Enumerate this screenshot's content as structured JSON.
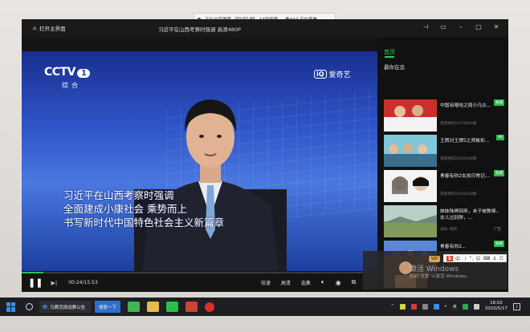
{
  "share_bar": {
    "status": "正在分享屏幕",
    "timer": "00:00:46",
    "watchers": "17列画面 ... 看34人正在观看"
  },
  "titlebar": {
    "home_label": "打开主界面",
    "video_title": "习近平在山西考察时强调 高清480P"
  },
  "video": {
    "channel_logo": "CCTV",
    "channel_number": "1",
    "channel_sub": "综合",
    "platform_logo": "爱奇艺",
    "subtitles": [
      "习近平在山西考察时强调",
      "全面建成小康社会 乘势而上",
      "书写新时代中国特色社会主义新篇章"
    ],
    "progress": 0.06
  },
  "controls": {
    "time": "00:24/15:53",
    "speed_label": "倍速",
    "quality_label": "高清",
    "other_label": "选集"
  },
  "panel": {
    "tab_label": "首页",
    "heading": "最你在追",
    "items": [
      {
        "badge": "独播",
        "title": "中国有嘻哈之局小凡众...",
        "meta": "或者更新20170826期"
      },
      {
        "badge": "4K",
        "title": "王牌对王牌5之郑俊彩...",
        "meta": "或者更新20200508期"
      },
      {
        "badge": "独播",
        "title": "青春有你2女孩日常记...",
        "meta": "或者更新20200430期"
      },
      {
        "badge": "",
        "title": "妹妹陆婷回来，夹子被数够，女儿过别胖，...",
        "meta": "发布:·更新",
        "ad": "广告"
      },
      {
        "badge": "独播",
        "title": "青春有你2...",
        "meta": ""
      }
    ]
  },
  "popup": {
    "vip": "VIP",
    "ime": "中"
  },
  "activation": {
    "title": "激活 Windows",
    "subtitle": "转到\"设置\"以激活 Windows。"
  },
  "taskbar": {
    "ie_label": "马赛克挑战赛公告",
    "search_label": "搜索一下",
    "time": "18:02",
    "date": "2020/5/17",
    "notifications": "2"
  },
  "colors": {
    "accent_green": "#27c24c",
    "badge_green": "#28b84a",
    "video_blue": "#2f55c9",
    "taskbar": "#1d1f22"
  }
}
